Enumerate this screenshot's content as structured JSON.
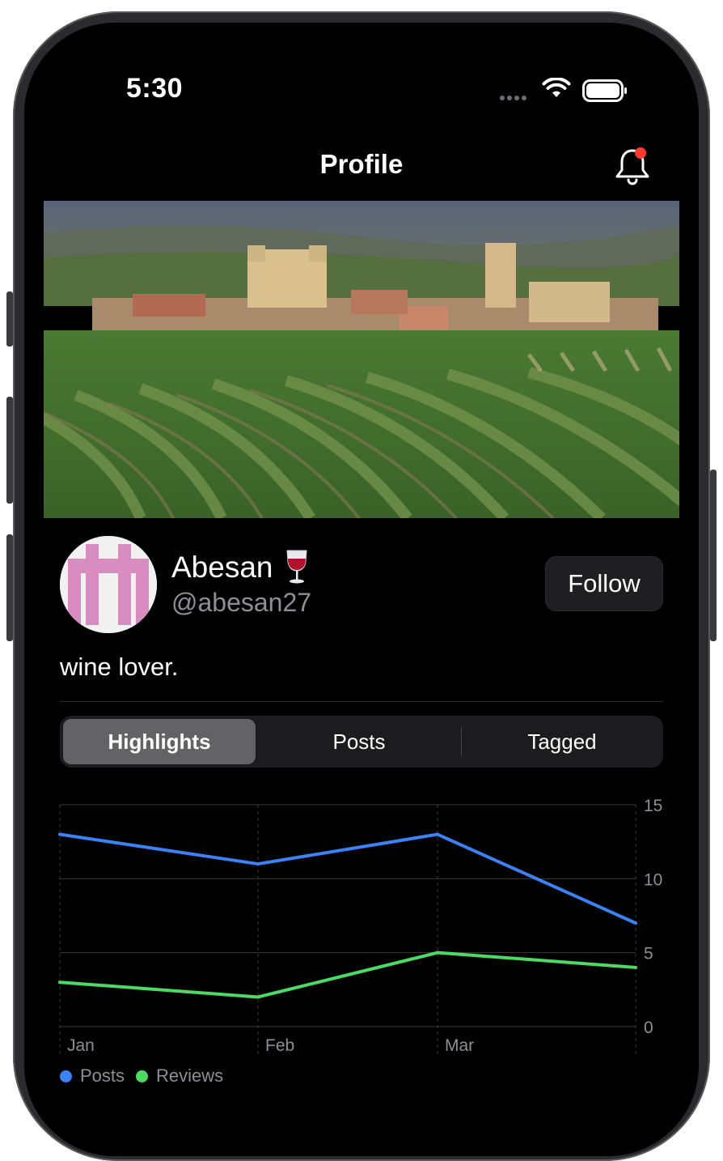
{
  "status_bar": {
    "time": "5:30"
  },
  "nav": {
    "title": "Profile",
    "notification_icon": "bell-icon",
    "has_unread": true
  },
  "profile": {
    "display_name": "Abesan",
    "name_emoji": "wine-glass",
    "handle": "@abesan27",
    "bio": "wine lover.",
    "follow_label": "Follow"
  },
  "tabs": [
    {
      "label": "Highlights",
      "selected": true
    },
    {
      "label": "Posts",
      "selected": false
    },
    {
      "label": "Tagged",
      "selected": false
    }
  ],
  "colors": {
    "posts": "#3b82f6",
    "reviews": "#4cd964",
    "background": "#000000",
    "notification_dot": "#ff3b30"
  },
  "chart_data": {
    "type": "line",
    "x": [
      "Jan",
      "Feb",
      "Mar",
      ""
    ],
    "series": [
      {
        "name": "Posts",
        "values": [
          13,
          11,
          13,
          7
        ]
      },
      {
        "name": "Reviews",
        "values": [
          3,
          2,
          5,
          4
        ]
      }
    ],
    "ylim": [
      0,
      15
    ],
    "yticks": [
      "0",
      "5",
      "10",
      "15"
    ],
    "grid": true,
    "legend": "bottom-left"
  }
}
